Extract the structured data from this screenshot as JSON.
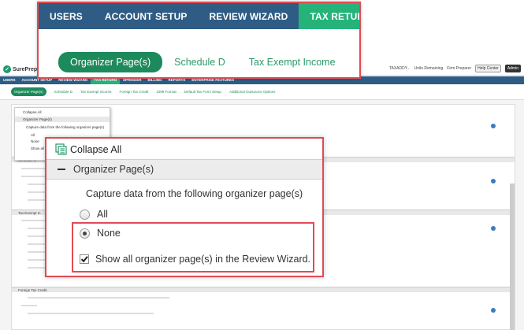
{
  "zoom_top": {
    "tabs": [
      {
        "label": "USERS"
      },
      {
        "label": "ACCOUNT SETUP"
      },
      {
        "label": "REVIEW WIZARD"
      },
      {
        "label": "TAX RETURN"
      }
    ],
    "subtabs": [
      {
        "label": "Organizer Page(s)"
      },
      {
        "label": "Schedule D"
      },
      {
        "label": "Tax Exempt Income"
      },
      {
        "label": "Fo"
      }
    ]
  },
  "background": {
    "logo_text": "SurePrep",
    "top_right": {
      "user": "TAXADDY...",
      "units": "Units Remaining",
      "role": "Firm Preparer",
      "help": "Help Center",
      "admin": "Admin"
    },
    "nav": [
      "USERS",
      "ACCOUNT SETUP",
      "REVIEW WIZARD",
      "TAX RETURN",
      "SPRINGER",
      "BILLING",
      "REPORTS",
      "ENTERPRISE FEATURES"
    ],
    "subnav": [
      "Organizer Page(s)",
      "Schedule D",
      "Tax Exempt Income",
      "Foreign Tax Credit",
      "1099 Format",
      "Default Tax Form Setup",
      "Additional Outsource Options"
    ],
    "sections": [
      "Schedule D",
      "Tax Exempt In",
      "Foreign Tax Credit"
    ],
    "thumb": {
      "collapse": "Collapse All",
      "section": "Organizer Page(s)",
      "capture": "Capture data from the following organizer page(s)",
      "all": "All",
      "none": "None",
      "show": "Show all o"
    }
  },
  "panel": {
    "collapse_all": "Collapse All",
    "section_title": "Organizer Page(s)",
    "capture_label": "Capture data from the following organizer page(s)",
    "options": [
      {
        "label": "All",
        "checked": false
      },
      {
        "label": "None",
        "checked": true
      }
    ],
    "show_all_label": "Show all organizer page(s) in the Review Wizard.",
    "show_all_checked": true
  },
  "colors": {
    "nav": "#2e5c84",
    "active_tab": "#25b37a",
    "subtab_text": "#2a9a6a",
    "highlight": "#e04b55"
  }
}
